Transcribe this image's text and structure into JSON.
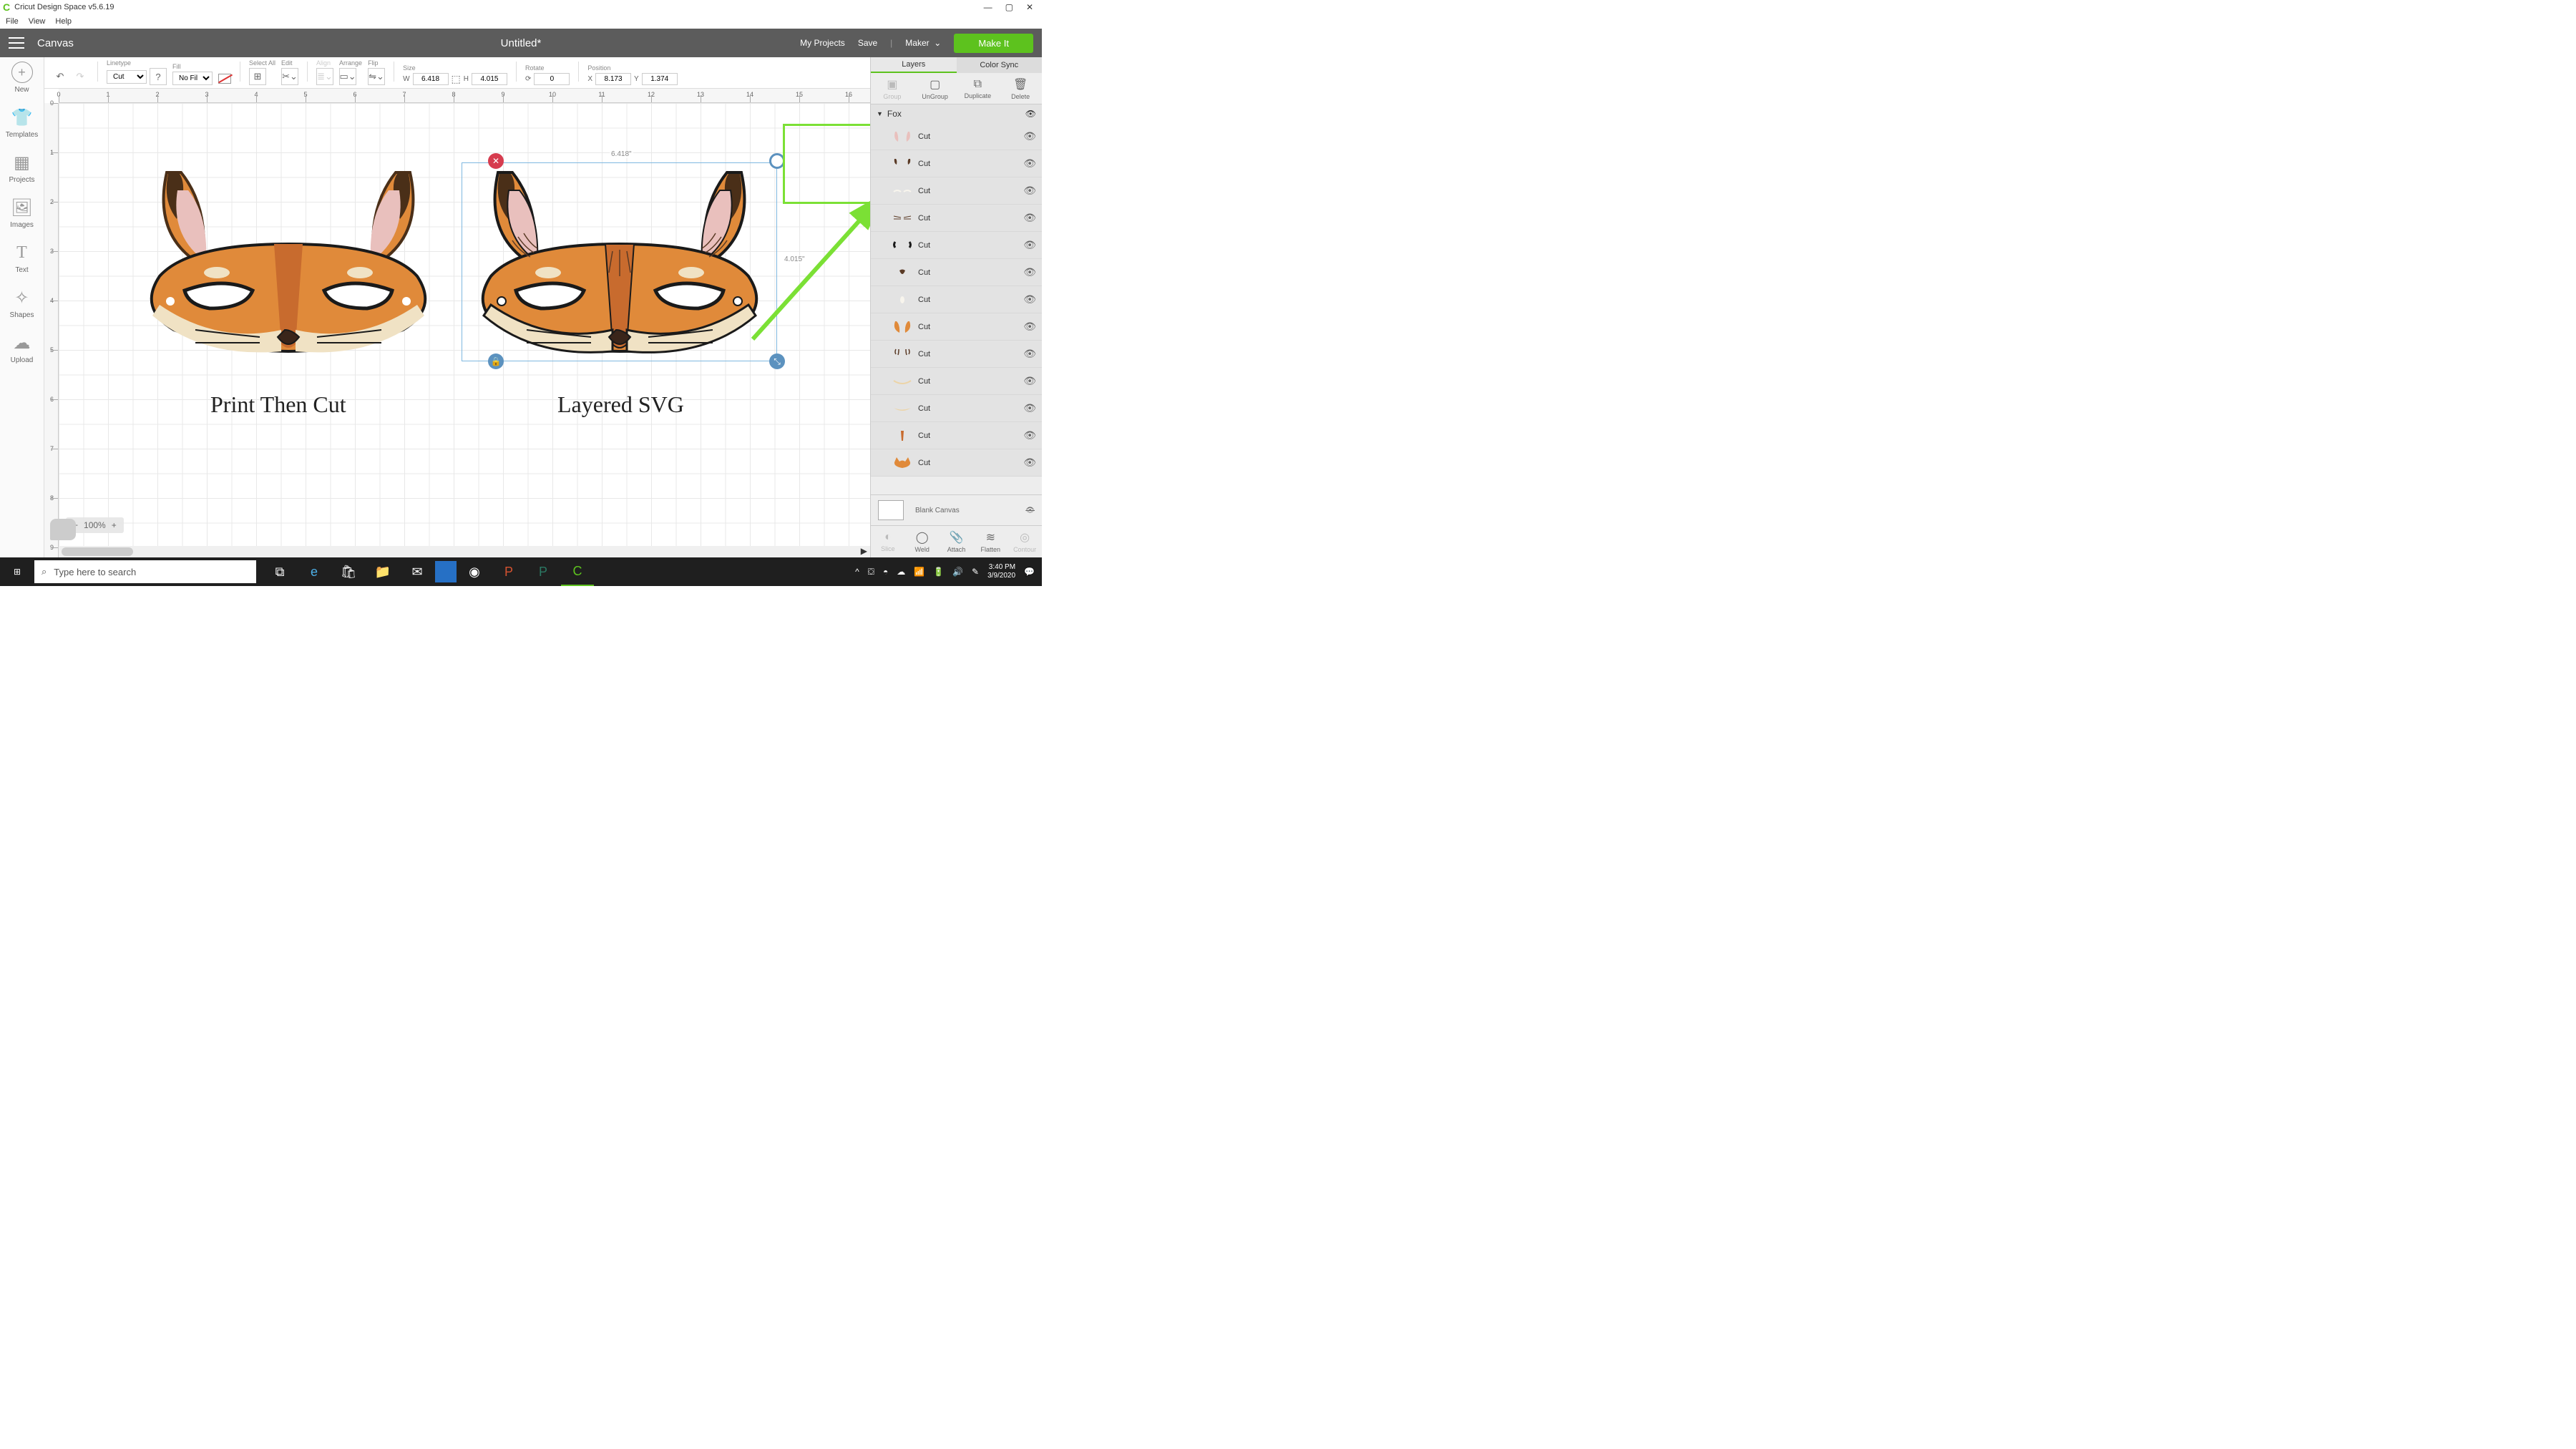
{
  "window": {
    "title": "Cricut Design Space v5.6.19"
  },
  "menu": {
    "file": "File",
    "view": "View",
    "help": "Help"
  },
  "topbar": {
    "canvas": "Canvas",
    "docTitle": "Untitled*",
    "myProjects": "My Projects",
    "save": "Save",
    "maker": "Maker",
    "makeIt": "Make It"
  },
  "lefttools": {
    "new": "New",
    "templates": "Templates",
    "projects": "Projects",
    "images": "Images",
    "text": "Text",
    "shapes": "Shapes",
    "upload": "Upload"
  },
  "toolbar": {
    "linetype": {
      "label": "Linetype",
      "value": "Cut"
    },
    "fill": {
      "label": "Fill",
      "value": "No Fill"
    },
    "selectAll": "Select All",
    "edit": "Edit",
    "align": "Align",
    "arrange": "Arrange",
    "flip": "Flip",
    "size": {
      "label": "Size",
      "w": "W",
      "wval": "6.418",
      "h": "H",
      "hval": "4.015"
    },
    "rotate": {
      "label": "Rotate",
      "value": "0"
    },
    "position": {
      "label": "Position",
      "x": "X",
      "xval": "8.173",
      "y": "Y",
      "yval": "1.374"
    }
  },
  "rightpanel": {
    "tabs": {
      "layers": "Layers",
      "colorSync": "Color Sync"
    },
    "actions": {
      "group": "Group",
      "ungroup": "UnGroup",
      "duplicate": "Duplicate",
      "delete": "Delete"
    },
    "groupName": "Fox",
    "layerLabel": "Cut",
    "blank": "Blank Canvas",
    "ops": {
      "slice": "Slice",
      "weld": "Weld",
      "attach": "Attach",
      "flatten": "Flatten",
      "contour": "Contour"
    }
  },
  "canvas": {
    "text1": "Print Then Cut",
    "text2": "Layered SVG",
    "selW": "6.418\"",
    "selH": "4.015\"",
    "zoom": "100%"
  },
  "taskbar": {
    "search": "Type here to search",
    "time": "3:40 PM",
    "date": "3/9/2020"
  },
  "layerColors": [
    "#e9c0bd",
    "#5a3a25",
    "#f8f5ed",
    "#5a3a25",
    "#1a1a1a",
    "#5a3a25",
    "#f8f5ed",
    "#e08a3a",
    "#5a3a25",
    "#ecd4a7",
    "#ecd4a7",
    "#c86b2e",
    "#e08a3a"
  ],
  "layerShapes": [
    "ears-inner",
    "ear-tips",
    "eye-tops",
    "whiskers",
    "eyes",
    "nose",
    "snout-highlight",
    "ears-outer",
    "ear-dark",
    "cheek-line",
    "cheek-light",
    "stripe",
    "face-base"
  ]
}
